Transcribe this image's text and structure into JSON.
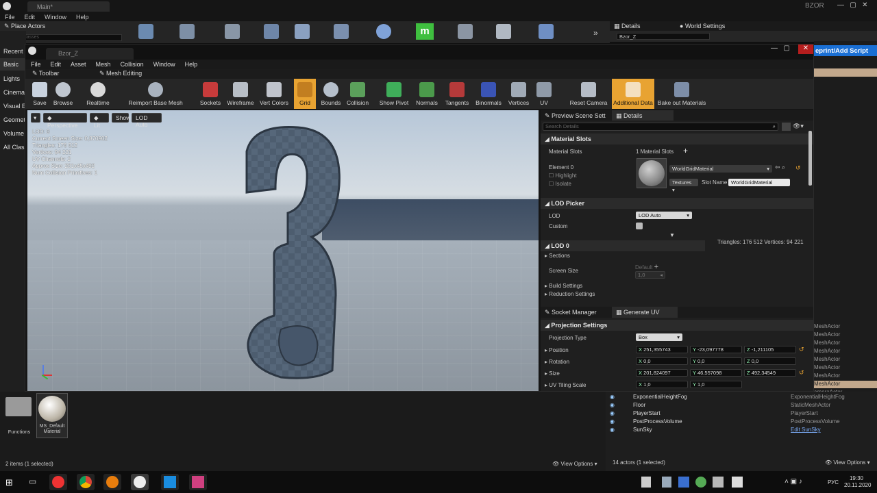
{
  "bg": {
    "tab_title": "Main*",
    "menu": [
      "File",
      "Edit",
      "Window",
      "Help"
    ],
    "place_actors": "Place Actors",
    "search_classes": "Search Classes",
    "left_items": [
      "Recent",
      "Basic",
      "Lights",
      "Cinema",
      "Visual E",
      "Geomet",
      "Volume",
      "All Clas"
    ],
    "tab_details": "Details",
    "tab_world_settings": "World Settings",
    "details_object": "Bzor_Z",
    "user": "BZOR",
    "add_script": "eprint/Add Script",
    "right_types": [
      "MeshActor",
      "MeshActor",
      "MeshActor",
      "MeshActor",
      "MeshActor",
      "MeshActor",
      "MeshActor",
      "MeshActor",
      "ameraActor"
    ]
  },
  "win": {
    "tab_title": "Bzor_Z",
    "menu": [
      "File",
      "Edit",
      "Asset",
      "Mesh",
      "Collision",
      "Window",
      "Help"
    ],
    "tabs": [
      "Toolbar",
      "Mesh Editing"
    ],
    "toolbar": [
      "Save",
      "Browse",
      "Realtime",
      "Reimport Base Mesh",
      "Sockets",
      "Wireframe",
      "Vert Colors",
      "Grid",
      "Bounds",
      "Collision",
      "Show Pivot",
      "Normals",
      "Tangents",
      "Binormals",
      "Vertices",
      "UV",
      "Reset Camera",
      "Additional Data",
      "Bake out Materials"
    ]
  },
  "viewport": {
    "buttons": [
      "Perspective",
      "Lit",
      "Show",
      "LOD Auto"
    ],
    "stats": [
      "LOD:  0",
      "Current Screen Size:  0,870902",
      "Triangles:  176 512",
      "Vertices:  94 221",
      "UV Channels:  2",
      "Approx Size: 201x45x492",
      "Num Collision Primitives:  1"
    ]
  },
  "details": {
    "tabs": [
      "Preview Scene Sett",
      "Details"
    ],
    "search_placeholder": "Search Details",
    "material_slots_header": "Material Slots",
    "material_slots_label": "Material Slots",
    "material_slots_value": "1 Material Slots",
    "element0": "Element 0",
    "highlight": "Highlight",
    "isolate": "Isolate",
    "material_name": "WorldGridMaterial",
    "textures": "Textures",
    "slot_name_label": "Slot Name",
    "slot_name_value": "WorldGridMaterial",
    "lod_picker_header": "LOD Picker",
    "lod_label": "LOD",
    "lod_value": "LOD Auto",
    "custom_label": "Custom",
    "lod_info": "Triangles: 176 512   Vertices: 94 221",
    "lod0_header": "LOD 0",
    "sections": "Sections",
    "default": "Default",
    "screen_size": "Screen Size",
    "screen_size_value": "1,0",
    "build_settings": "Build Settings",
    "reduction_settings": "Reduction Settings",
    "socket_manager": "Socket Manager",
    "generate_uv": "Generate UV",
    "projection_header": "Projection Settings",
    "projection_type_label": "Projection Type",
    "projection_type_value": "Box",
    "position_label": "Position",
    "position": [
      "251,355743",
      "-23,097778",
      "-1,211105"
    ],
    "rotation_label": "Rotation",
    "rotation": [
      "0,0",
      "0,0",
      "0,0"
    ],
    "size_label": "Size",
    "size": [
      "201,824097",
      "46,557098",
      "492,34549"
    ],
    "uv_tiling_label": "UV Tiling Scale",
    "uv_tiling": [
      "1,0",
      "1,0"
    ]
  },
  "content": {
    "folder_label": "Functions",
    "asset_label": "MS_Default Material",
    "items_count": "2 items (1 selected)",
    "view_options": "View Options"
  },
  "outliner": {
    "rows": [
      {
        "name": "ExponentialHeightFog",
        "type": "ExponentialHeightFog"
      },
      {
        "name": "Floor",
        "type": "StaticMeshActor"
      },
      {
        "name": "PlayerStart",
        "type": "PlayerStart"
      },
      {
        "name": "PostProcessVolume",
        "type": "PostProcessVolume"
      },
      {
        "name": "SunSky",
        "type": "Edit SunSky"
      }
    ],
    "actors_count": "14 actors (1 selected)",
    "view_options": "View Options"
  },
  "taskbar": {
    "lang": "РУС",
    "time": "19:30",
    "date": "20.11.2020"
  }
}
